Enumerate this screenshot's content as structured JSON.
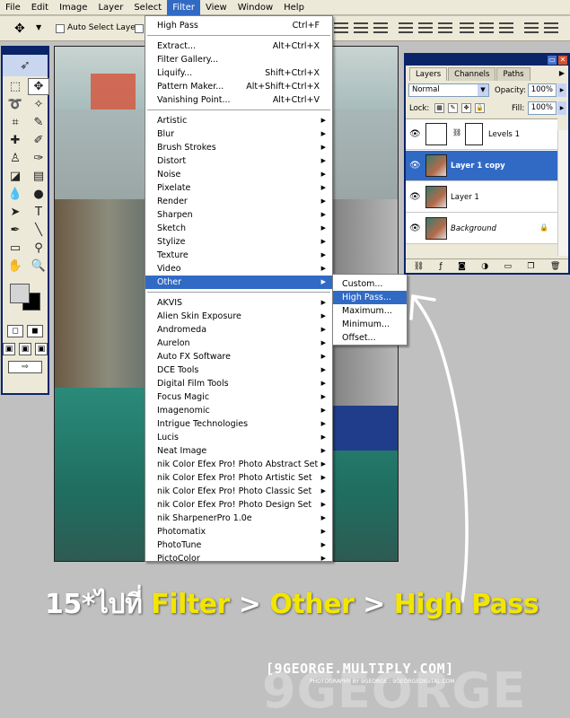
{
  "menubar": {
    "items": [
      "File",
      "Edit",
      "Image",
      "Layer",
      "Select",
      "Filter",
      "View",
      "Window",
      "Help"
    ],
    "active": "Filter"
  },
  "options_bar": {
    "auto_select_label": "Auto Select Layer"
  },
  "filter_menu": {
    "top_items": [
      {
        "label": "High Pass",
        "shortcut": "Ctrl+F"
      },
      {
        "label": "Extract...",
        "shortcut": "Alt+Ctrl+X"
      },
      {
        "label": "Filter Gallery...",
        "shortcut": ""
      },
      {
        "label": "Liquify...",
        "shortcut": "Shift+Ctrl+X"
      },
      {
        "label": "Pattern Maker...",
        "shortcut": "Alt+Shift+Ctrl+X"
      },
      {
        "label": "Vanishing Point...",
        "shortcut": "Alt+Ctrl+V"
      }
    ],
    "builtin_items": [
      "Artistic",
      "Blur",
      "Brush Strokes",
      "Distort",
      "Noise",
      "Pixelate",
      "Render",
      "Sharpen",
      "Sketch",
      "Stylize",
      "Texture",
      "Video",
      "Other"
    ],
    "plugin_items": [
      "AKVIS",
      "Alien Skin Exposure",
      "Andromeda",
      "Aurelon",
      "Auto FX Software",
      "DCE Tools",
      "Digital Film Tools",
      "Focus Magic",
      "Imagenomic",
      "Intrigue Technologies",
      "Lucis",
      "Neat Image",
      "nik Color Efex Pro! Photo Abstract Set",
      "nik Color Efex Pro! Photo Artistic Set",
      "nik Color Efex Pro! Photo Classic Set",
      "nik Color Efex Pro! Photo Design Set",
      "nik SharpenerPro 1.0e",
      "Photomatix",
      "PhotoTune",
      "PictoColor"
    ],
    "highlighted": "Other"
  },
  "other_submenu": {
    "items": [
      "Custom...",
      "High Pass...",
      "Maximum...",
      "Minimum...",
      "Offset..."
    ],
    "highlighted": "High Pass..."
  },
  "layers_panel": {
    "tabs": [
      "Layers",
      "Channels",
      "Paths"
    ],
    "active_tab": "Layers",
    "blend_mode": "Normal",
    "opacity_label": "Opacity:",
    "opacity_value": "100%",
    "lock_label": "Lock:",
    "fill_label": "Fill:",
    "fill_value": "100%",
    "layers": [
      {
        "name": "Levels 1",
        "selected": false,
        "adjustment": true
      },
      {
        "name": "Layer 1 copy",
        "selected": true,
        "adjustment": false
      },
      {
        "name": "Layer 1",
        "selected": false,
        "adjustment": false
      },
      {
        "name": "Background",
        "selected": false,
        "adjustment": false,
        "locked": true
      }
    ]
  },
  "caption": {
    "prefix": "15*ไปที่",
    "step1": "Filter",
    "sep": ">",
    "step2": "Other",
    "step3": "High Pass"
  },
  "watermark": {
    "title": "[9GEORGE.MULTIPLY.COM]",
    "big": "9GEORGE",
    "line1": "PHOTOGRAPHY BY 9GEORGE : 9GEORGEDIGITAL.COM"
  },
  "colors": {
    "menu_highlight": "#316ac5",
    "caption_yellow": "#f2e600",
    "titlebar_blue": "#0a246a"
  }
}
